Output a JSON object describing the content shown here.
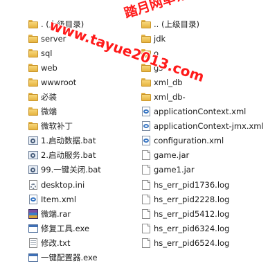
{
  "file_list": {
    "left": [
      {
        "name": ". (上级目录)",
        "type": "folder"
      },
      {
        "name": "server",
        "type": "folder"
      },
      {
        "name": "sql",
        "type": "folder"
      },
      {
        "name": "web",
        "type": "folder"
      },
      {
        "name": "wwwroot",
        "type": "folder"
      },
      {
        "name": "必装",
        "type": "folder"
      },
      {
        "name": "微端",
        "type": "folder"
      },
      {
        "name": "微软补丁",
        "type": "folder"
      },
      {
        "name": "1.启动数据.bat",
        "type": "bat"
      },
      {
        "name": "2.启动服务.bat",
        "type": "bat"
      },
      {
        "name": "99.一键关闭.bat",
        "type": "bat"
      },
      {
        "name": "desktop.ini",
        "type": "ini"
      },
      {
        "name": "Item.xml",
        "type": "xml"
      },
      {
        "name": "微端.rar",
        "type": "rar"
      },
      {
        "name": "修复工具.exe",
        "type": "exe"
      },
      {
        "name": "修改.txt",
        "type": "txt"
      },
      {
        "name": "一键配置器.exe",
        "type": "exe"
      }
    ],
    "right": [
      {
        "name": ".. (上级目录)",
        "type": "folder"
      },
      {
        "name": "jdk",
        "type": "folder"
      },
      {
        "name": "o",
        "type": "folder"
      },
      {
        "name": "gs",
        "type": "folder"
      },
      {
        "name": "xml_db",
        "type": "folder"
      },
      {
        "name": "xml_db-",
        "type": "folder"
      },
      {
        "name": "applicationContext.xml",
        "type": "xml"
      },
      {
        "name": "applicationContext-jmx.xml",
        "type": "xml"
      },
      {
        "name": "configuration.xml",
        "type": "xml"
      },
      {
        "name": "game.jar",
        "type": "doc"
      },
      {
        "name": "game1.jar",
        "type": "doc"
      },
      {
        "name": "hs_err_pid1736.log",
        "type": "doc"
      },
      {
        "name": "hs_err_pid2228.log",
        "type": "doc"
      },
      {
        "name": "hs_err_pid5412.log",
        "type": "doc"
      },
      {
        "name": "hs_err_pid6324.log",
        "type": "doc"
      },
      {
        "name": "hs_err_pid6524.log",
        "type": "doc"
      }
    ]
  },
  "watermark": {
    "title": "踏月网单论坛",
    "url": "www.tayue2013.com",
    "color": "#ff1a1a",
    "stroke": "#ffffff"
  }
}
